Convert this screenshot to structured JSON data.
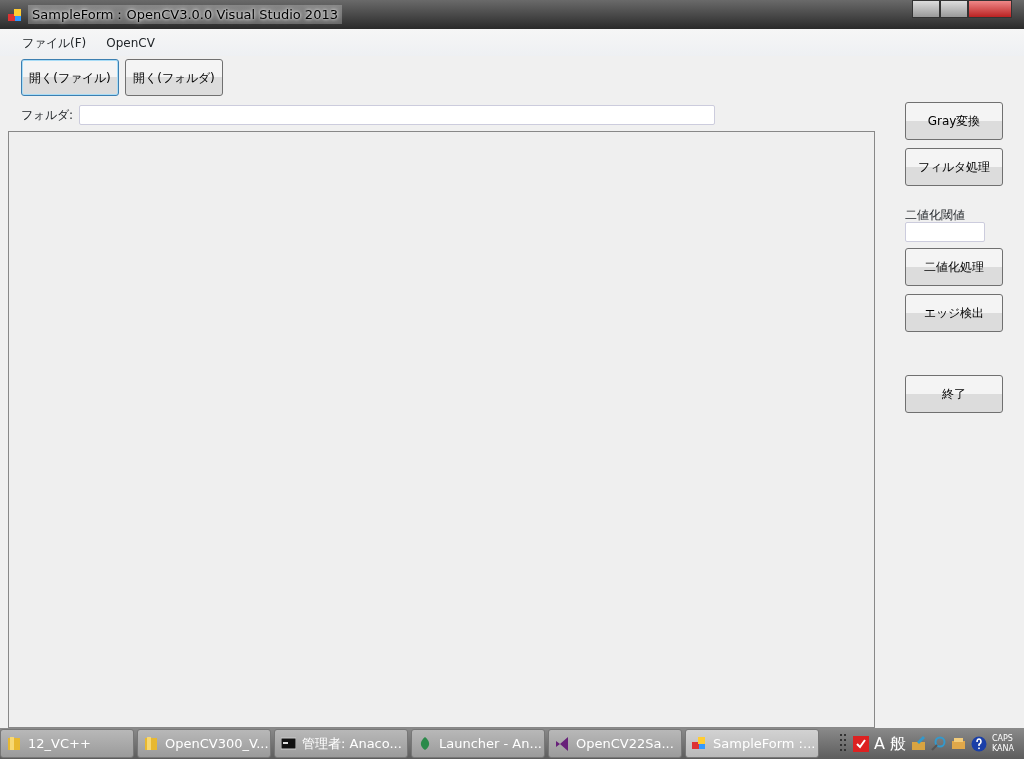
{
  "window": {
    "title": "SampleForm：OpenCV3.0.0 Visual Studio 2013"
  },
  "menu": [
    {
      "label": "ファイル(F)"
    },
    {
      "label": "OpenCV"
    }
  ],
  "toolbar": [
    {
      "label": "開く(ファイル)",
      "focused": true
    },
    {
      "label": "開く(フォルダ)",
      "focused": false
    }
  ],
  "folder": {
    "label": "フォルダ:"
  },
  "side_panel": [
    {
      "kind": "button",
      "label": "Gray変換"
    },
    {
      "kind": "button",
      "label": "フィルタ処理"
    },
    {
      "kind": "label",
      "label": "二値化閾値"
    },
    {
      "kind": "field"
    },
    {
      "kind": "button",
      "label": "二値化処理"
    },
    {
      "kind": "button",
      "label": "エッジ検出"
    },
    {
      "kind": "spacer"
    },
    {
      "kind": "button",
      "label": "終了"
    }
  ],
  "taskbar": [
    {
      "label": "12_VC++",
      "kind": "folder",
      "selected": false
    },
    {
      "label": "OpenCV300_V...",
      "kind": "folder",
      "selected": false
    },
    {
      "label": "管理者: Anaco...",
      "kind": "console",
      "selected": false
    },
    {
      "label": "Launcher - An...",
      "kind": "leaf",
      "selected": false
    },
    {
      "label": "OpenCV22Sa...",
      "kind": "vs",
      "selected": false
    },
    {
      "label": "SampleForm :...",
      "kind": "form",
      "selected": true
    }
  ],
  "tray": {
    "ime_mode": "A",
    "ime_kana": "般",
    "caps": "CAPS",
    "kana": "KANA"
  }
}
